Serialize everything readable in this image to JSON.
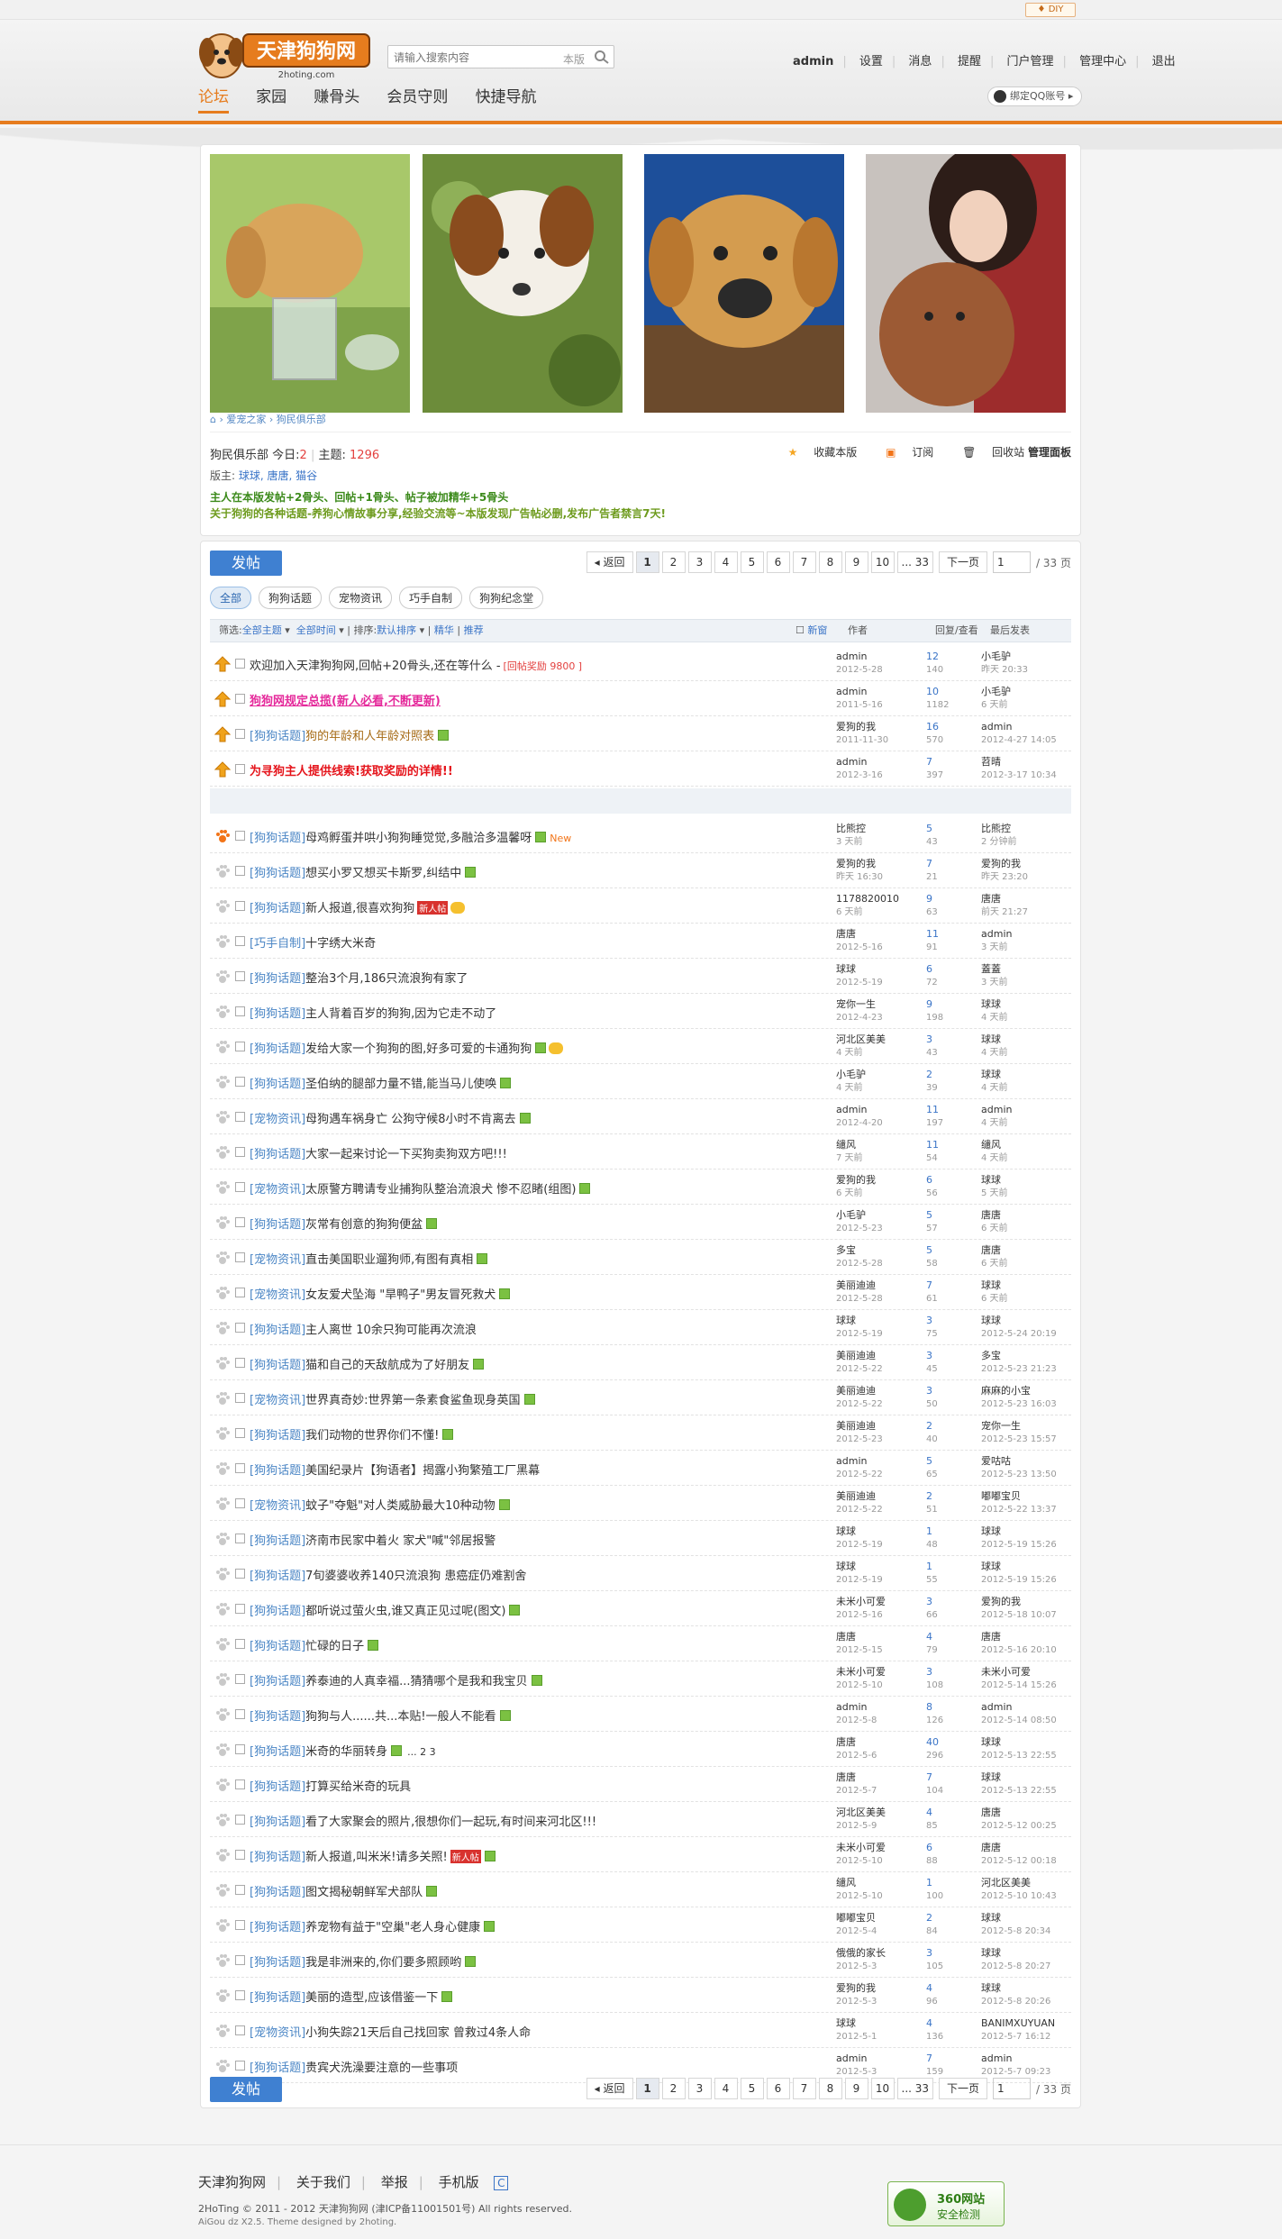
{
  "header": {
    "diy_label": "DIY",
    "search_placeholder": "请输入搜索内容",
    "search_scope": "本版",
    "user_links": [
      "admin",
      "设置",
      "消息",
      "提醒",
      "门户管理",
      "管理中心",
      "退出"
    ],
    "nav": [
      "论坛",
      "家园",
      "赚骨头",
      "会员守则",
      "快捷导航"
    ],
    "qq_bind": "绑定QQ账号"
  },
  "forum": {
    "breadcrumb": [
      "爱宠之家",
      "狗民俱乐部"
    ],
    "name": "狗民俱乐部",
    "today_label": "今日:",
    "today": "2",
    "topics_label": "主题:",
    "topics": "1296",
    "mods_label": "版主:",
    "mods": "球球, 唐唐, 猫谷",
    "rule1": "主人在本版发帖+2骨头、回帖+1骨头、帖子被加精华+5骨头",
    "rule2": "关于狗狗的各种话题-养狗心情故事分享,经验交流等~本版发现广告帖必删,发布广告者禁言7天!",
    "actions": [
      "收藏本版",
      "订阅",
      "回收站",
      "管理面板"
    ]
  },
  "toolbar": {
    "post_label": "发帖",
    "pager_prev": "返回",
    "pages": [
      "1",
      "2",
      "3",
      "4",
      "5",
      "6",
      "7",
      "8",
      "9",
      "10",
      "... 33"
    ],
    "pager_next": "下一页",
    "page_input": "1",
    "pager_total": "/ 33 页",
    "types": [
      "全部",
      "狗狗话题",
      "宠物资讯",
      "巧手自制",
      "狗狗纪念堂"
    ]
  },
  "filter": {
    "label": "筛选:",
    "all_topics": "全部主题",
    "all_time": "全部时间",
    "sort_label": "排序:",
    "sort": "默认排序",
    "digest": "精华",
    "recommend": "推荐",
    "new_label": "新窗",
    "col_author": "作者",
    "col_counts": "回复/查看",
    "col_last": "最后发表"
  },
  "sticky": [
    {
      "title": "欢迎加入天津狗狗网,回帖+20骨头,还在等什么 -",
      "extra": "[回帖奖励 9800 ]",
      "style": "tx",
      "author": "admin",
      "adate": "2012-5-28",
      "replies": "12",
      "views": "140",
      "lpuser": "小毛驴",
      "lpdate": "昨天 20:33"
    },
    {
      "title": "狗狗网规定总揽(新人必看,不断更新)",
      "style": "tx pink",
      "author": "admin",
      "adate": "2011-5-16",
      "replies": "10",
      "views": "1182",
      "lpuser": "小毛驴",
      "lpdate": "6 天前"
    },
    {
      "cat": "[狗狗话题]",
      "title": "狗的年龄和人年龄对照表",
      "style": "tx gold",
      "att": true,
      "author": "爱狗的我",
      "adate": "2011-11-30",
      "replies": "16",
      "views": "570",
      "lpuser": "admin",
      "lpdate": "2012-4-27 14:05"
    },
    {
      "title": "为寻狗主人提供线索!获取奖励的详情!!",
      "style": "tx red",
      "author": "admin",
      "adate": "2012-3-16",
      "replies": "7",
      "views": "397",
      "lpuser": "苕晴",
      "lpdate": "2012-3-17 10:34"
    }
  ],
  "threads": [
    {
      "cat": "[狗狗话题]",
      "title": "母鸡孵蛋并哄小狗狗睡觉觉,多融洽多温馨呀",
      "att": true,
      "newtag": "New",
      "author": "比熊控",
      "adate": "3 天前",
      "replies": "5",
      "views": "43",
      "lpuser": "比熊控",
      "lpdate": "2 分钟前",
      "paw": true
    },
    {
      "cat": "[狗狗话题]",
      "title": "想买小罗又想买卡斯罗,纠结中",
      "att": true,
      "author": "爱狗的我",
      "adate": "昨天 16:30",
      "replies": "7",
      "views": "21",
      "lpuser": "爱狗的我",
      "lpdate": "昨天 23:20"
    },
    {
      "cat": "[狗狗话题]",
      "title": "新人报道,很喜欢狗狗",
      "newbie": "新人帖",
      "hot": true,
      "author": "1178820010",
      "adate": "6 天前",
      "replies": "9",
      "views": "63",
      "lpuser": "唐唐",
      "lpdate": "前天 21:27"
    },
    {
      "cat": "[巧手自制]",
      "title": "十字绣大米奇",
      "author": "唐唐",
      "adate": "2012-5-16",
      "replies": "11",
      "views": "91",
      "lpuser": "admin",
      "lpdate": "3 天前"
    },
    {
      "cat": "[狗狗话题]",
      "title": "整治3个月,186只流浪狗有家了",
      "author": "球球",
      "adate": "2012-5-19",
      "replies": "6",
      "views": "72",
      "lpuser": "蓋蓋",
      "lpdate": "3 天前"
    },
    {
      "cat": "[狗狗话题]",
      "title": "主人背着百岁的狗狗,因为它走不动了",
      "author": "宠你一生",
      "adate": "2012-4-23",
      "replies": "9",
      "views": "198",
      "lpuser": "球球",
      "lpdate": "4 天前"
    },
    {
      "cat": "[狗狗话题]",
      "title": "发给大家一个狗狗的图,好多可爱的卡通狗狗",
      "att": true,
      "hot": true,
      "author": "河北区美美",
      "adate": "4 天前",
      "replies": "3",
      "views": "43",
      "lpuser": "球球",
      "lpdate": "4 天前"
    },
    {
      "cat": "[狗狗话题]",
      "title": "圣伯纳的腿部力量不错,能当马儿使唤",
      "att": true,
      "author": "小毛驴",
      "adate": "4 天前",
      "replies": "2",
      "views": "39",
      "lpuser": "球球",
      "lpdate": "4 天前"
    },
    {
      "cat": "[宠物资讯]",
      "title": "母狗遇车祸身亡 公狗守候8小时不肯离去",
      "att": true,
      "author": "admin",
      "adate": "2012-4-20",
      "replies": "11",
      "views": "197",
      "lpuser": "admin",
      "lpdate": "4 天前"
    },
    {
      "cat": "[狗狗话题]",
      "title": "大家一起来讨论一下买狗卖狗双方吧!!!",
      "author": "缱风",
      "adate": "7 天前",
      "replies": "11",
      "views": "54",
      "lpuser": "缱风",
      "lpdate": "4 天前"
    },
    {
      "cat": "[宠物资讯]",
      "title": "太原警方聘请专业捕狗队整治流浪犬 惨不忍睹(组图)",
      "att": true,
      "author": "爱狗的我",
      "adate": "6 天前",
      "replies": "6",
      "views": "56",
      "lpuser": "球球",
      "lpdate": "5 天前"
    },
    {
      "cat": "[狗狗话题]",
      "title": "灰常有创意的狗狗便盆",
      "att": true,
      "author": "小毛驴",
      "adate": "2012-5-23",
      "replies": "5",
      "views": "57",
      "lpuser": "唐唐",
      "lpdate": "6 天前"
    },
    {
      "cat": "[宠物资讯]",
      "title": "直击美国职业遛狗师,有图有真相",
      "att": true,
      "author": "多宝",
      "adate": "2012-5-28",
      "replies": "5",
      "views": "58",
      "lpuser": "唐唐",
      "lpdate": "6 天前"
    },
    {
      "cat": "[宠物资讯]",
      "title": "女友爱犬坠海 \"旱鸭子\"男友冒死救犬",
      "att": true,
      "author": "美丽迪迪",
      "adate": "2012-5-28",
      "replies": "7",
      "views": "61",
      "lpuser": "球球",
      "lpdate": "6 天前"
    },
    {
      "cat": "[狗狗话题]",
      "title": "主人离世 10余只狗可能再次流浪",
      "author": "球球",
      "adate": "2012-5-19",
      "replies": "3",
      "views": "75",
      "lpuser": "球球",
      "lpdate": "2012-5-24 20:19"
    },
    {
      "cat": "[狗狗话题]",
      "title": "猫和自己的天敌航成为了好朋友",
      "att": true,
      "author": "美丽迪迪",
      "adate": "2012-5-22",
      "replies": "3",
      "views": "45",
      "lpuser": "多宝",
      "lpdate": "2012-5-23 21:23"
    },
    {
      "cat": "[宠物资讯]",
      "title": "世界真奇妙:世界第一条素食鲨鱼现身英国",
      "att": true,
      "author": "美丽迪迪",
      "adate": "2012-5-22",
      "replies": "3",
      "views": "50",
      "lpuser": "麻麻的小宝",
      "lpdate": "2012-5-23 16:03"
    },
    {
      "cat": "[狗狗话题]",
      "title": "我们动物的世界你们不懂!",
      "att": true,
      "author": "美丽迪迪",
      "adate": "2012-5-23",
      "replies": "2",
      "views": "40",
      "lpuser": "宠你一生",
      "lpdate": "2012-5-23 15:57"
    },
    {
      "cat": "[狗狗话题]",
      "title": "美国纪录片【狗语者】揭露小狗繁殖工厂黑幕",
      "author": "admin",
      "adate": "2012-5-22",
      "replies": "5",
      "views": "65",
      "lpuser": "爱咕咕",
      "lpdate": "2012-5-23 13:50"
    },
    {
      "cat": "[宠物资讯]",
      "title": "蚊子\"夺魁\"对人类威胁最大10种动物",
      "att": true,
      "author": "美丽迪迪",
      "adate": "2012-5-22",
      "replies": "2",
      "views": "51",
      "lpuser": "嘟嘟宝贝",
      "lpdate": "2012-5-22 13:37"
    },
    {
      "cat": "[狗狗话题]",
      "title": "济南市民家中着火 家犬\"喊\"邻居报警",
      "author": "球球",
      "adate": "2012-5-19",
      "replies": "1",
      "views": "48",
      "lpuser": "球球",
      "lpdate": "2012-5-19 15:26"
    },
    {
      "cat": "[狗狗话题]",
      "title": "7旬婆婆收养140只流浪狗 患癌症仍难割舍",
      "author": "球球",
      "adate": "2012-5-19",
      "replies": "1",
      "views": "55",
      "lpuser": "球球",
      "lpdate": "2012-5-19 15:26"
    },
    {
      "cat": "[狗狗话题]",
      "title": "都听说过萤火虫,谁又真正见过呢(图文)",
      "att": true,
      "author": "未米小可爱",
      "adate": "2012-5-16",
      "replies": "3",
      "views": "66",
      "lpuser": "爱狗的我",
      "lpdate": "2012-5-18 10:07"
    },
    {
      "cat": "[狗狗话题]",
      "title": "忙碌的日子",
      "att": true,
      "author": "唐唐",
      "adate": "2012-5-15",
      "replies": "4",
      "views": "79",
      "lpuser": "唐唐",
      "lpdate": "2012-5-16 20:10"
    },
    {
      "cat": "[狗狗话题]",
      "title": "养泰迪的人真幸福...猜猜哪个是我和我宝贝",
      "att": true,
      "author": "未米小可爱",
      "adate": "2012-5-10",
      "replies": "3",
      "views": "108",
      "lpuser": "未米小可爱",
      "lpdate": "2012-5-14 15:26"
    },
    {
      "cat": "[狗狗话题]",
      "title": "狗狗与人......共...本贴!一般人不能看",
      "att": true,
      "author": "admin",
      "adate": "2012-5-8",
      "replies": "8",
      "views": "126",
      "lpuser": "admin",
      "lpdate": "2012-5-14 08:50"
    },
    {
      "cat": "[狗狗话题]",
      "title": "米奇的华丽转身",
      "att": true,
      "pages": "... 2 3",
      "author": "唐唐",
      "adate": "2012-5-6",
      "replies": "40",
      "views": "296",
      "lpuser": "球球",
      "lpdate": "2012-5-13 22:55"
    },
    {
      "cat": "[狗狗话题]",
      "title": "打算买给米奇的玩具",
      "author": "唐唐",
      "adate": "2012-5-7",
      "replies": "7",
      "views": "104",
      "lpuser": "球球",
      "lpdate": "2012-5-13 22:55"
    },
    {
      "cat": "[狗狗话题]",
      "title": "看了大家聚会的照片,很想你们一起玩,有时间来河北区!!!",
      "author": "河北区美美",
      "adate": "2012-5-9",
      "replies": "4",
      "views": "85",
      "lpuser": "唐唐",
      "lpdate": "2012-5-12 00:25"
    },
    {
      "cat": "[狗狗话题]",
      "title": "新人报道,叫米米!请多关照!",
      "newbie": "新人帖",
      "att": true,
      "author": "未米小可爱",
      "adate": "2012-5-10",
      "replies": "6",
      "views": "88",
      "lpuser": "唐唐",
      "lpdate": "2012-5-12 00:18"
    },
    {
      "cat": "[狗狗话题]",
      "title": "图文揭秘朝鲜军犬部队",
      "att": true,
      "author": "缱风",
      "adate": "2012-5-10",
      "replies": "1",
      "views": "100",
      "lpuser": "河北区美美",
      "lpdate": "2012-5-10 10:43"
    },
    {
      "cat": "[狗狗话题]",
      "title": "养宠物有益于\"空巢\"老人身心健康",
      "att": true,
      "author": "嘟嘟宝贝",
      "adate": "2012-5-4",
      "replies": "2",
      "views": "84",
      "lpuser": "球球",
      "lpdate": "2012-5-8 20:34"
    },
    {
      "cat": "[狗狗话题]",
      "title": "我是非洲来的,你们要多照顾哟",
      "att": true,
      "author": "俄俄的家长",
      "adate": "2012-5-3",
      "replies": "3",
      "views": "105",
      "lpuser": "球球",
      "lpdate": "2012-5-8 20:27"
    },
    {
      "cat": "[狗狗话题]",
      "title": "美丽的造型,应该借鉴一下",
      "att": true,
      "author": "爱狗的我",
      "adate": "2012-5-3",
      "replies": "4",
      "views": "96",
      "lpuser": "球球",
      "lpdate": "2012-5-8 20:26"
    },
    {
      "cat": "[宠物资讯]",
      "title": "小狗失踪21天后自己找回家 曾救过4条人命",
      "author": "球球",
      "adate": "2012-5-1",
      "replies": "4",
      "views": "136",
      "lpuser": "BANIMXUYUAN",
      "lpdate": "2012-5-7 16:12"
    },
    {
      "cat": "[狗狗话题]",
      "title": "贵宾犬洗澡要注意的一些事项",
      "author": "admin",
      "adate": "2012-5-3",
      "replies": "7",
      "views": "159",
      "lpuser": "admin",
      "lpdate": "2012-5-7 09:23"
    }
  ],
  "footer": {
    "links": [
      "天津狗狗网",
      "关于我们",
      "举报",
      "手机版"
    ],
    "copyright": "2HoTing © 2011 - 2012 天津狗狗网 (津ICP备11001501号) All rights reserved.",
    "powered": "AiGou dz X2.5. Theme designed by 2hoting.",
    "badge_t1": "360网站",
    "badge_t2": "安全检测"
  },
  "colors": {
    "accent": "#e67c1e",
    "link": "#3a74c7",
    "post_button": "#3f80d1"
  }
}
